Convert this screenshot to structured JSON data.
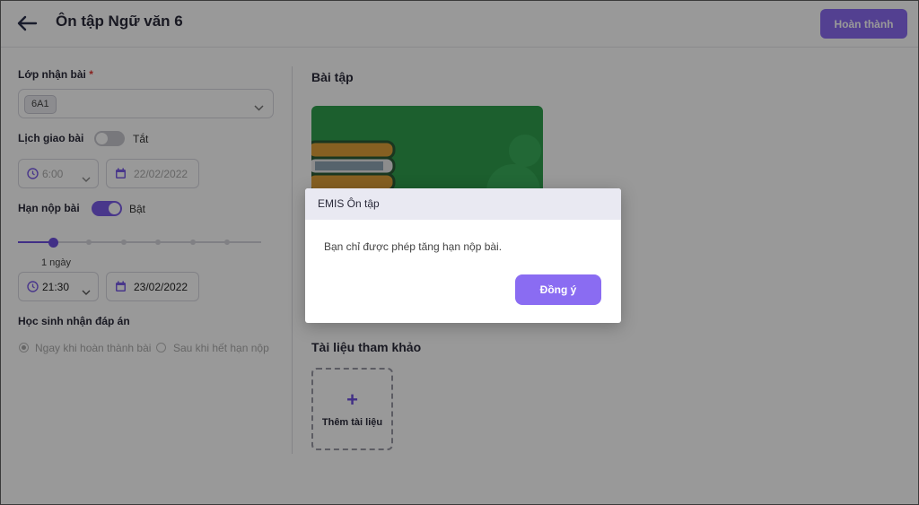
{
  "header": {
    "title": "Ôn tập Ngữ văn 6",
    "finish_label": "Hoàn thành"
  },
  "form": {
    "class_label": "Lớp nhận bài",
    "required_mark": "*",
    "class_selected": "6A1",
    "schedule_label": "Lịch giao bài",
    "schedule_toggle_text": "Tắt",
    "schedule_time": "6:00",
    "schedule_date": "22/02/2022",
    "deadline_label": "Hạn nộp bài",
    "deadline_toggle_text": "Bật",
    "deadline_slider_caption": "1 ngày",
    "deadline_slider_level": 0.14,
    "deadline_time": "21:30",
    "deadline_date": "23/02/2022",
    "answer_label": "Học sinh nhận đáp án",
    "answer_options": [
      "Ngay khi hoàn thành bài",
      "Sau khi hết hạn nộp"
    ]
  },
  "main": {
    "exercise_title": "Bài tập",
    "reference_title": "Tài liệu tham khảo",
    "add_reference_label": "Thêm tài liệu"
  },
  "dialog": {
    "title": "EMIS Ôn tập",
    "message": "Bạn chỉ được phép tăng hạn nộp bài.",
    "ok_label": "Đồng ý"
  },
  "colors": {
    "accent": "#8a6cf2",
    "card_green": "#2f9f4e"
  }
}
